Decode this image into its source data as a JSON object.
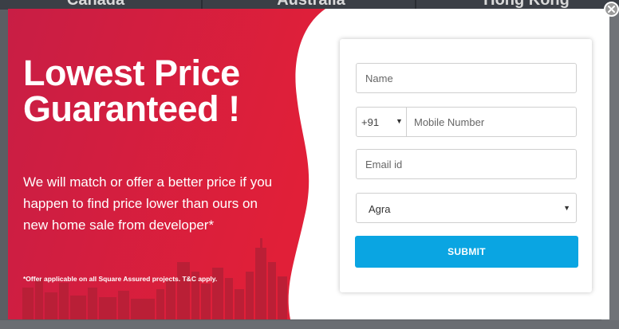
{
  "background": {
    "top_labels": [
      "Canada",
      "Australia",
      "Hong Kong"
    ]
  },
  "promo": {
    "headline_line1": "Lowest Price",
    "headline_line2": "Guaranteed !",
    "description": "We will match or offer a better price if you happen to find price lower than ours on new home sale from developer*",
    "disclaimer": "*Offer applicable on all Square Assured projects. T&C apply.",
    "colors": {
      "gradient_start": "#c81e45",
      "gradient_end": "#e11f38",
      "skyline": "#b52036"
    }
  },
  "form": {
    "name_placeholder": "Name",
    "country_code": "+91",
    "mobile_placeholder": "Mobile Number",
    "email_placeholder": "Email id",
    "city_selected": "Agra",
    "submit_label": "SUBMIT",
    "colors": {
      "submit": "#0aa5e2"
    }
  },
  "icons": {
    "close": "close-icon",
    "select_caret": "caret-down-icon"
  }
}
